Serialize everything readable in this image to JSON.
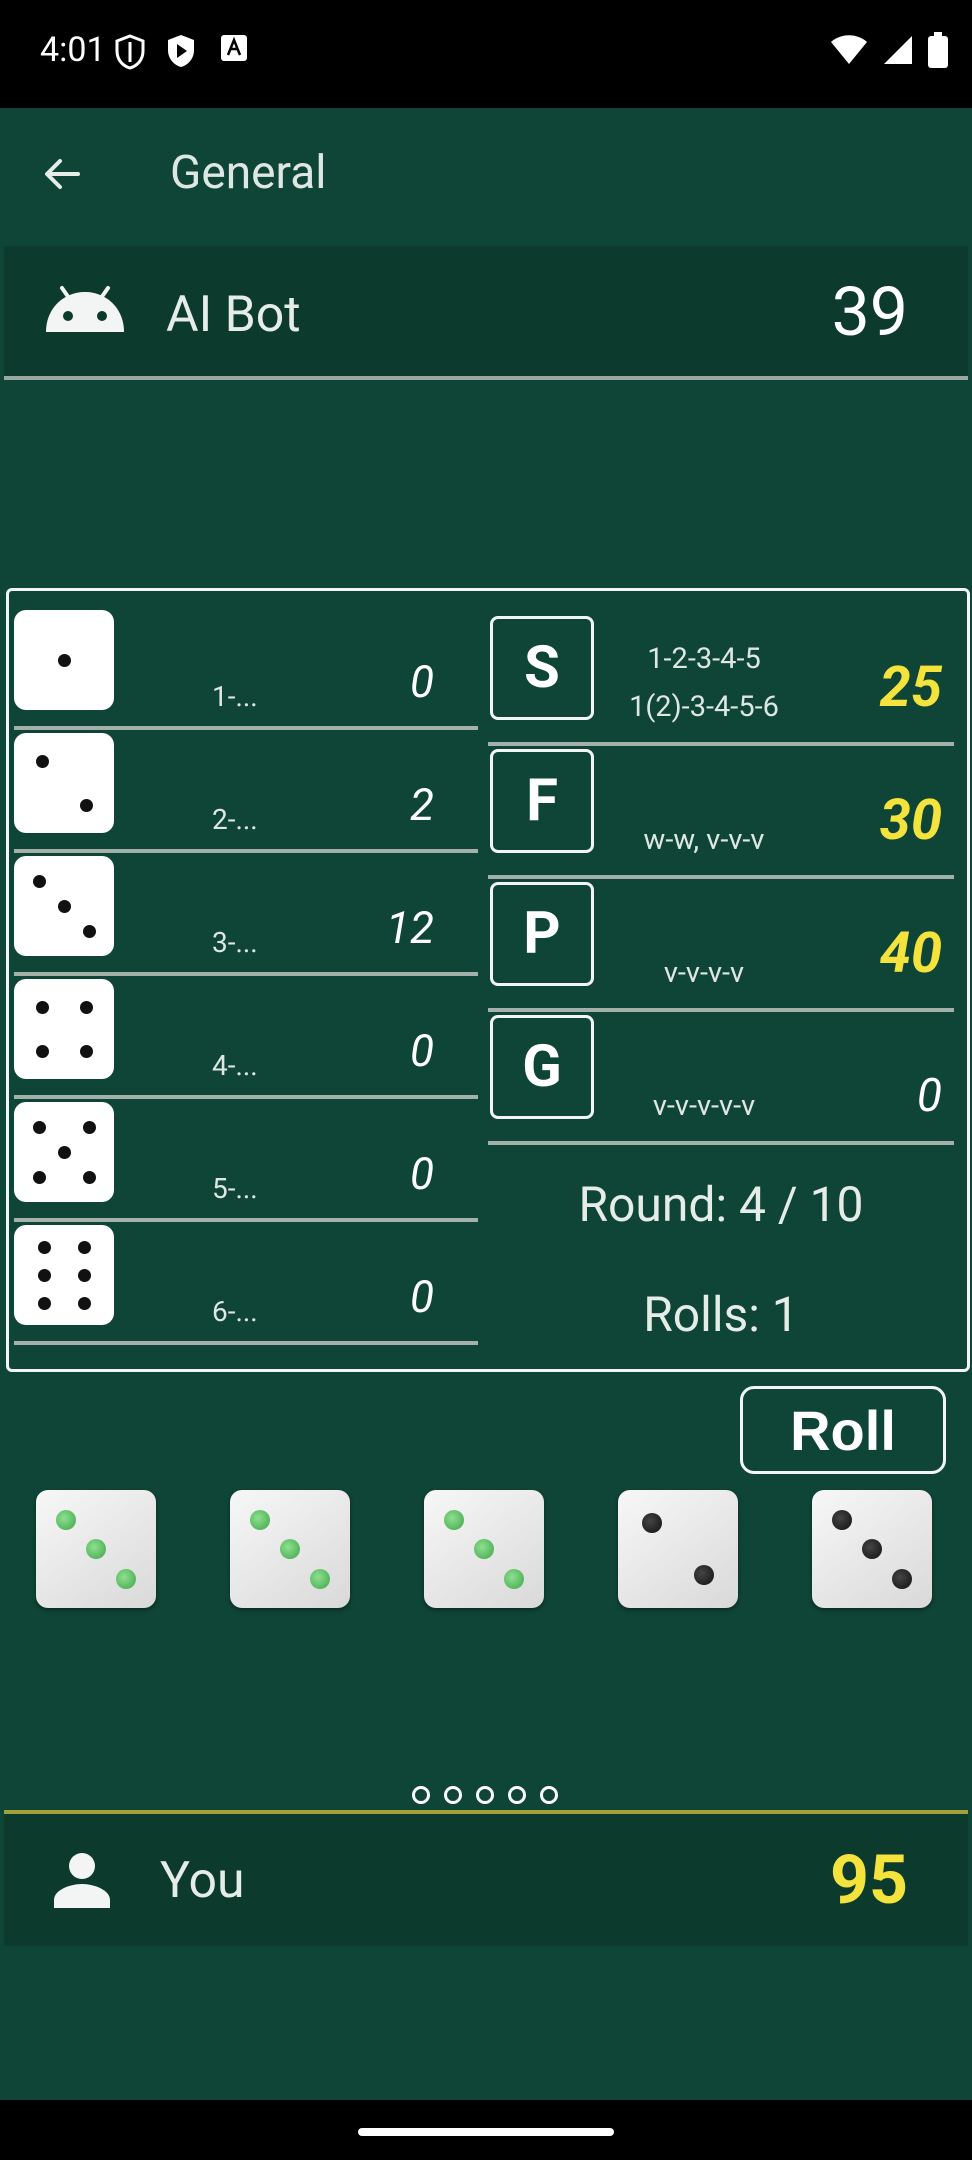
{
  "status_bar": {
    "time": "4:01"
  },
  "app_bar": {
    "title": "General"
  },
  "opponent": {
    "name": "AI Bot",
    "score": "39"
  },
  "number_rows": [
    {
      "label": "1-...",
      "score": "0",
      "pips": 1
    },
    {
      "label": "2-...",
      "score": "2",
      "pips": 2
    },
    {
      "label": "3-...",
      "score": "12",
      "pips": 3
    },
    {
      "label": "4-...",
      "score": "0",
      "pips": 4
    },
    {
      "label": "5-...",
      "score": "0",
      "pips": 5
    },
    {
      "label": "6-...",
      "score": "0",
      "pips": 6
    }
  ],
  "categories": [
    {
      "letter": "S",
      "combo_line1": "1-2-3-4-5",
      "combo_line2": "1(2)-3-4-5-6",
      "score": "25"
    },
    {
      "letter": "F",
      "combo_line1": "w-w, v-v-v",
      "score": "30"
    },
    {
      "letter": "P",
      "combo_line1": "v-v-v-v",
      "score": "40"
    },
    {
      "letter": "G",
      "combo_line1": "v-v-v-v-v",
      "score": "0"
    }
  ],
  "round": {
    "text": "Round: 4 / 10"
  },
  "rolls": {
    "text": "Rolls:  1"
  },
  "roll_button": {
    "label": "Roll"
  },
  "dice_tray": [
    {
      "value": 3,
      "held": true
    },
    {
      "value": 3,
      "held": true
    },
    {
      "value": 3,
      "held": true
    },
    {
      "value": 2,
      "held": false
    },
    {
      "value": 3,
      "held": false
    }
  ],
  "player": {
    "name": "You",
    "score": "95"
  },
  "colors": {
    "table_green": "#0f4536",
    "score_yellow": "#f4e33d",
    "held_pip_green": "#3fa44a"
  }
}
